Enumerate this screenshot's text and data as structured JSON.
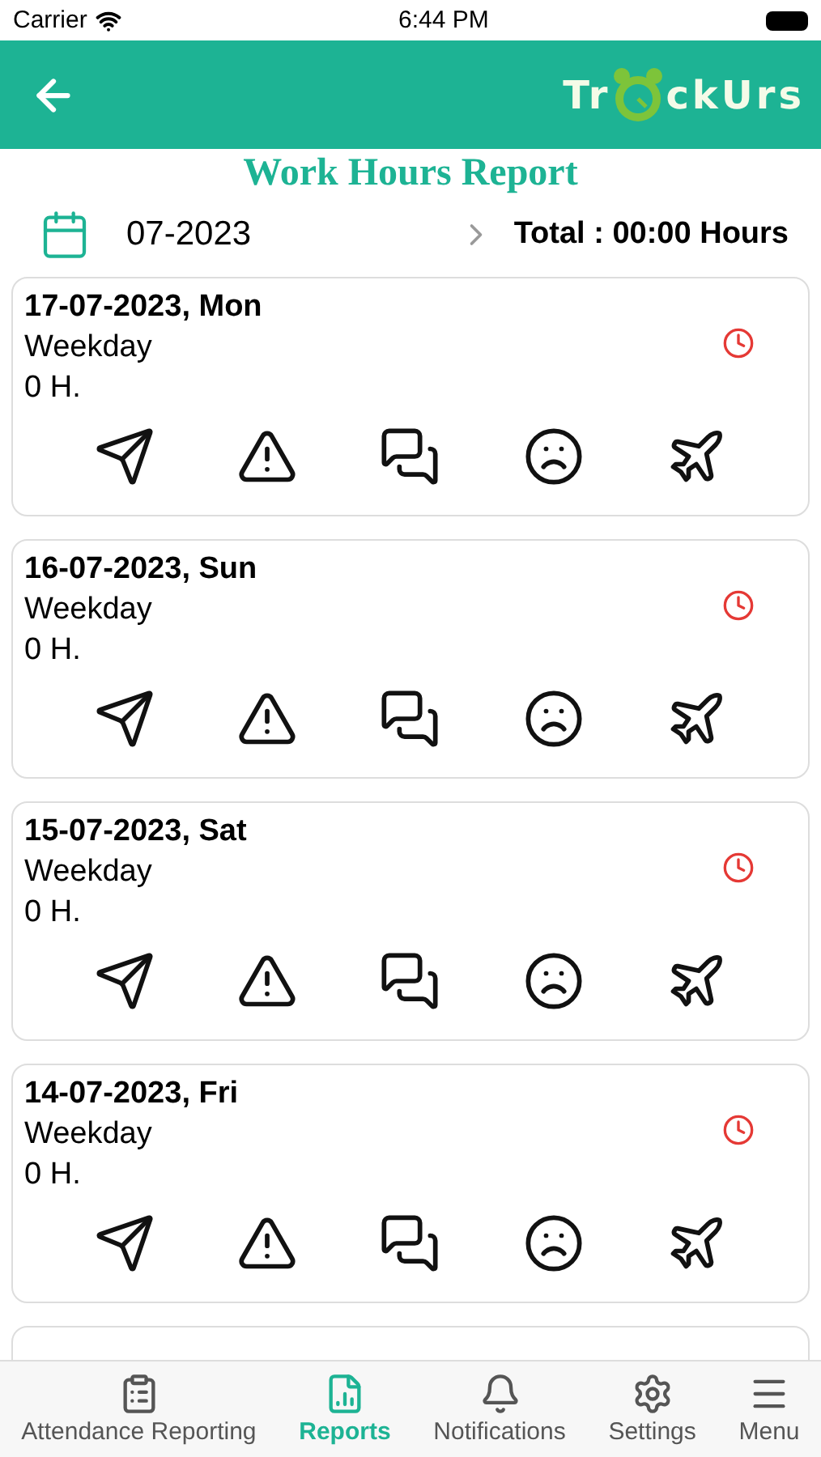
{
  "status_bar": {
    "carrier": "Carrier",
    "time": "6:44 PM"
  },
  "header": {
    "logo_left": "Tr",
    "logo_right": "ckUrs"
  },
  "title": "Work Hours Report",
  "month": {
    "value": "07-2023",
    "total": "Total : 00:00 Hours"
  },
  "days": [
    {
      "date": "17-07-2023, Mon",
      "type": "Weekday",
      "hours": "0 H."
    },
    {
      "date": "16-07-2023, Sun",
      "type": "Weekday",
      "hours": "0 H."
    },
    {
      "date": "15-07-2023, Sat",
      "type": "Weekday",
      "hours": "0 H."
    },
    {
      "date": "14-07-2023, Fri",
      "type": "Weekday",
      "hours": "0 H."
    }
  ],
  "tabs": [
    {
      "kind": "attendance",
      "label": "Attendance Reporting",
      "selected": false
    },
    {
      "kind": "reports",
      "label": "Reports",
      "selected": true
    },
    {
      "kind": "notifications",
      "label": "Notifications",
      "selected": false
    },
    {
      "kind": "settings",
      "label": "Settings",
      "selected": false
    },
    {
      "kind": "menu",
      "label": "Menu",
      "selected": false
    }
  ]
}
